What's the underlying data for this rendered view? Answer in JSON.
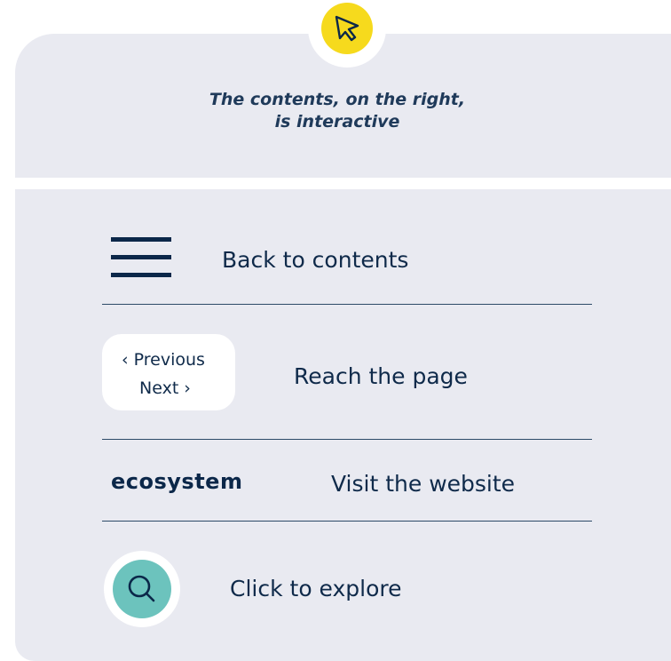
{
  "headline": {
    "line1": "The contents, on the right,",
    "line2": "is interactive"
  },
  "rows": {
    "back_to_contents": "Back to contents",
    "reach_page": "Reach the page",
    "visit_website": "Visit the website",
    "click_to_explore": "Click to explore"
  },
  "pager": {
    "previous": "‹ Previous",
    "next": "Next ›"
  },
  "logo": {
    "text": "ecosystem"
  },
  "icons": {
    "cursor": "cursor-pointer-icon",
    "menu": "hamburger-menu-icon",
    "search": "magnifier-icon"
  },
  "colors": {
    "background_card": "#e9eaf1",
    "accent_yellow": "#f6da1d",
    "accent_teal": "#6cc3bd",
    "navy": "#0b2749"
  }
}
